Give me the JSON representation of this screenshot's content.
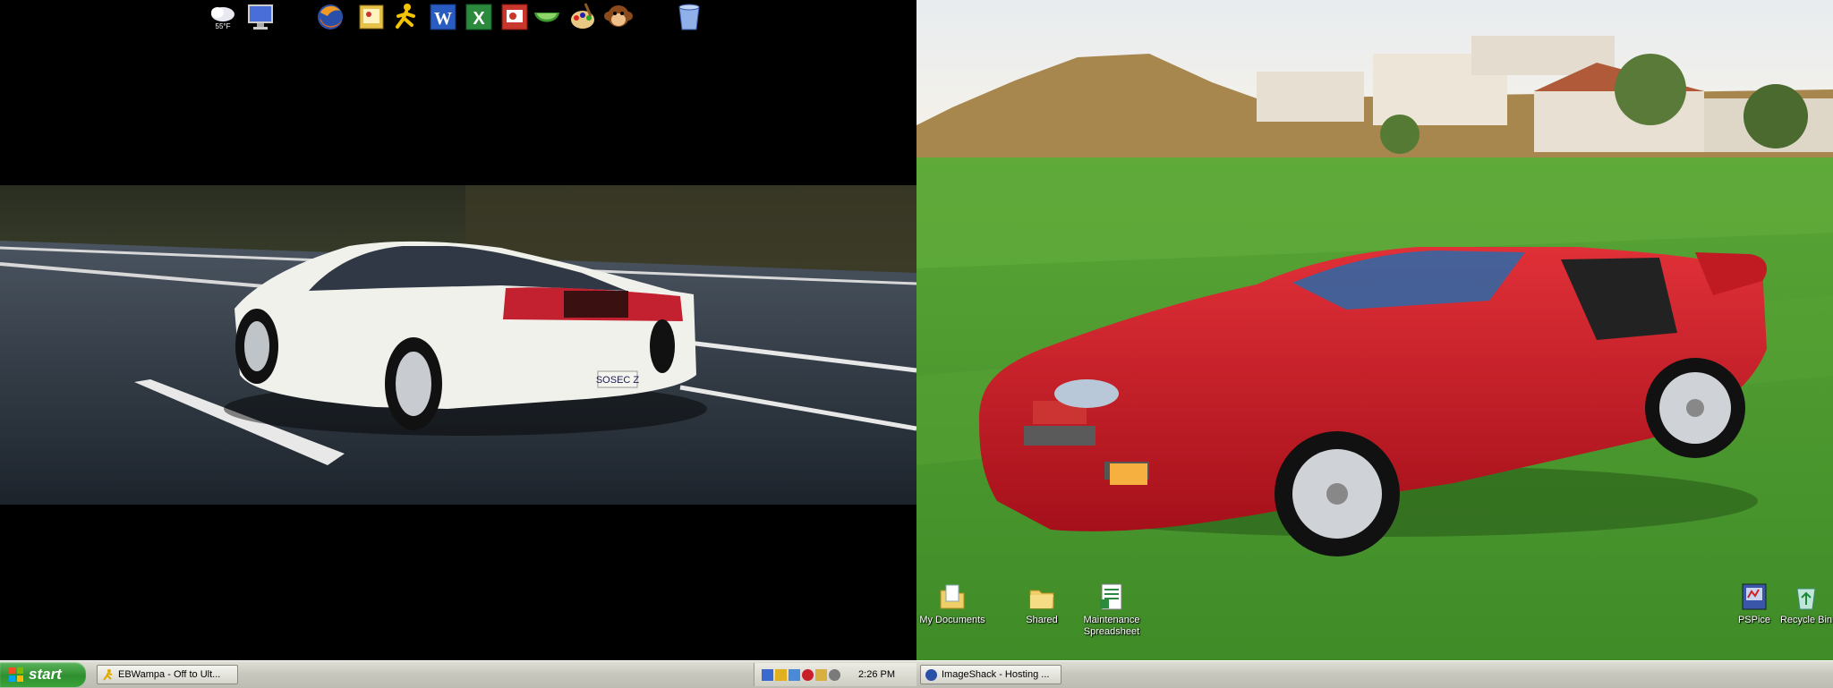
{
  "dock": {
    "weather_temp": "55°F",
    "icons": [
      "weather-icon",
      "monitor-icon",
      "firefox-icon",
      "photo-viewer-icon",
      "aim-running-man-icon",
      "word-icon",
      "excel-icon",
      "powerpoint-icon",
      "melon-icon",
      "paint-palette-icon",
      "monkey-icon",
      "recycle-bin-dock-icon"
    ]
  },
  "left_photo": {
    "license_plate": "SOSEC Z",
    "car_color": "#f2f2ee"
  },
  "right_photo": {
    "car_color": "#c8151e",
    "grass_color": "#4e9b2f"
  },
  "desktop_icons": [
    {
      "label": "My Documents",
      "icon": "my-documents-icon"
    },
    {
      "label": "Shared",
      "icon": "shared-folder-icon"
    },
    {
      "label": "Maintenance Spreadsheet",
      "icon": "spreadsheet-icon"
    },
    {
      "label": "PSPice",
      "icon": "pspice-icon"
    },
    {
      "label": "Recycle Bin",
      "icon": "recycle-bin-icon"
    }
  ],
  "taskbar_left": {
    "start_label": "start",
    "task_button": "EBWampa - Off to Ult..."
  },
  "taskbar_right": {
    "clock": "2:26 PM",
    "task_button": "ImageShack - Hosting ..."
  },
  "colors": {
    "taskbar": "#d4d3c9",
    "start_green": "#3aa43a"
  }
}
